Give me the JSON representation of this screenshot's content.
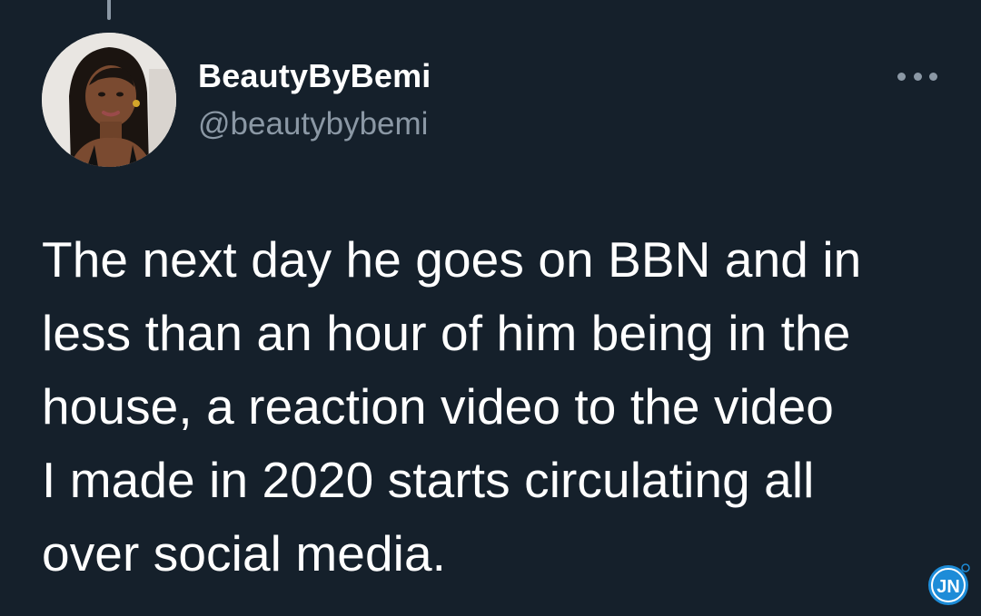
{
  "tweet": {
    "author": {
      "display_name": "BeautyByBemi",
      "handle": "@beautybybemi",
      "avatar_icon": "profile-photo"
    },
    "more_icon": "ellipsis-icon",
    "text_lines": [
      "The next day he goes on BBN and in",
      "less than an hour of him being in the",
      "house, a reaction video to the video",
      "I made in 2020 starts circulating all",
      "over social media."
    ]
  },
  "watermark": {
    "text": "JN",
    "icon": "jn-logo"
  },
  "colors": {
    "background": "#15202b",
    "primary_text": "#ffffff",
    "secondary_text": "#8b98a5",
    "watermark_blue": "#1d8cd8"
  }
}
